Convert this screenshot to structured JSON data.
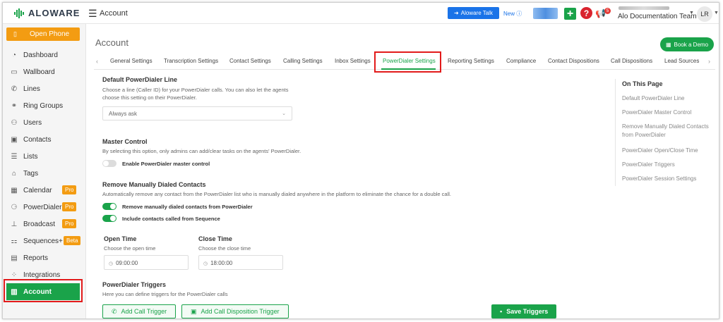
{
  "topbar": {
    "brand": "ALOWARE",
    "title": "Account",
    "talk_button": "Aloware Talk",
    "new_label": "New",
    "team_name": "Alo Documentation Team",
    "avatar_initials": "LR",
    "notification_count": "5"
  },
  "sidebar": {
    "open_phone": "Open Phone",
    "items": [
      {
        "label": "Dashboard",
        "icon": "speedometer-icon"
      },
      {
        "label": "Wallboard",
        "icon": "monitor-icon"
      },
      {
        "label": "Lines",
        "icon": "phone-line-icon"
      },
      {
        "label": "Ring Groups",
        "icon": "ring-group-icon"
      },
      {
        "label": "Users",
        "icon": "users-icon"
      },
      {
        "label": "Contacts",
        "icon": "contact-card-icon"
      },
      {
        "label": "Lists",
        "icon": "list-icon"
      },
      {
        "label": "Tags",
        "icon": "tag-icon"
      },
      {
        "label": "Calendar",
        "icon": "calendar-icon",
        "badge": "Pro"
      },
      {
        "label": "PowerDialer",
        "icon": "power-dialer-icon",
        "badge": "Pro"
      },
      {
        "label": "Broadcast",
        "icon": "broadcast-icon",
        "badge": "Pro"
      },
      {
        "label": "Sequences+",
        "icon": "sequences-icon",
        "badge": "Beta"
      },
      {
        "label": "Reports",
        "icon": "reports-icon"
      },
      {
        "label": "Integrations",
        "icon": "integrations-icon"
      },
      {
        "label": "Account",
        "icon": "account-chart-icon",
        "active": true
      }
    ]
  },
  "main": {
    "title": "Account",
    "book_demo": "Book a Demo",
    "tabs": [
      "General Settings",
      "Transcription Settings",
      "Contact Settings",
      "Calling Settings",
      "Inbox Settings",
      "PowerDialer Settings",
      "Reporting Settings",
      "Compliance",
      "Contact Dispositions",
      "Call Dispositions",
      "Lead Sources"
    ],
    "active_tab": "PowerDialer Settings"
  },
  "settings": {
    "default_line": {
      "title": "Default PowerDialer Line",
      "desc_line1": "Choose a line (Caller ID) for your PowerDialer calls. You can also let the agents",
      "desc_line2": "choose this setting on their PowerDialer.",
      "selected": "Always ask"
    },
    "master_control": {
      "title": "Master Control",
      "desc": "By selecting this option, only admins can add/clear tasks on the agents' PowerDialer.",
      "toggle_label": "Enable PowerDialer master control",
      "enabled": false
    },
    "remove_manual": {
      "title": "Remove Manually Dialed Contacts",
      "desc": "Automatically remove any contact from the PowerDialer list who is manually dialed anywhere in the platform to eliminate the chance for a double call.",
      "toggle1_label": "Remove manually dialed contacts from PowerDialer",
      "toggle1_enabled": true,
      "toggle2_label": "Include contacts called from Sequence",
      "toggle2_enabled": true
    },
    "open_time": {
      "title": "Open Time",
      "desc": "Choose the open time",
      "value": "09:00:00"
    },
    "close_time": {
      "title": "Close Time",
      "desc": "Choose the close time",
      "value": "18:00:00"
    },
    "triggers": {
      "title": "PowerDialer Triggers",
      "desc": "Here you can define triggers for the PowerDialer calls",
      "add_call_trigger": "Add Call Trigger",
      "add_disposition_trigger": "Add Call Disposition Trigger",
      "save_triggers": "Save Triggers"
    }
  },
  "toc": {
    "title": "On This Page",
    "items": [
      "Default PowerDialer Line",
      "PowerDialer Master Control",
      "Remove Manually Dialed Contacts from PowerDialer",
      "PowerDialer Open/Close Time",
      "PowerDialer Triggers",
      "PowerDialer Session Settings"
    ]
  },
  "colors": {
    "brand_green": "#1aa34a",
    "orange": "#f39c12",
    "blue": "#1a73e8",
    "highlight_red": "#e21b1b"
  }
}
